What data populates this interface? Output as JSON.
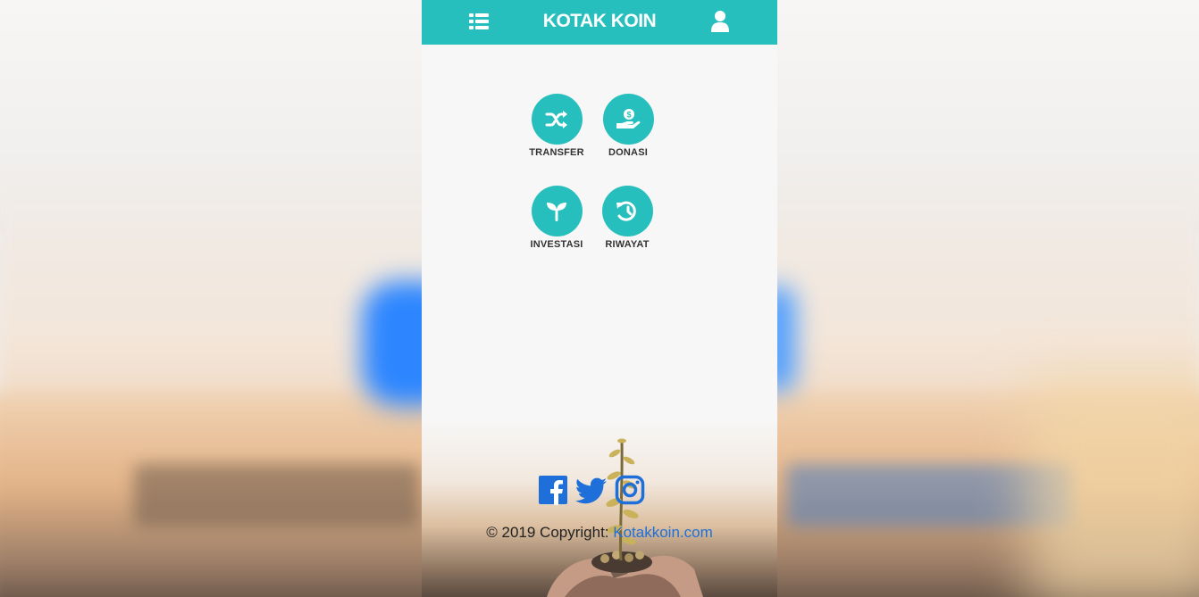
{
  "header": {
    "title": "KOTAK KOIN",
    "menu_icon": "list-icon",
    "user_icon": "user-icon"
  },
  "menu": [
    {
      "label": "TRANSFER",
      "icon": "shuffle-icon"
    },
    {
      "label": "DONASI",
      "icon": "donate-hand-icon"
    },
    {
      "label": "INVESTASI",
      "icon": "seedling-icon"
    },
    {
      "label": "RIWAYAT",
      "icon": "history-icon"
    }
  ],
  "footer": {
    "social": [
      "facebook-icon",
      "twitter-icon",
      "instagram-icon"
    ],
    "copyright_prefix": "© 2019 Copyright: ",
    "copyright_link": "Kotakkoin.com"
  },
  "colors": {
    "accent": "#26bfbd",
    "link": "#1e6fd9"
  }
}
